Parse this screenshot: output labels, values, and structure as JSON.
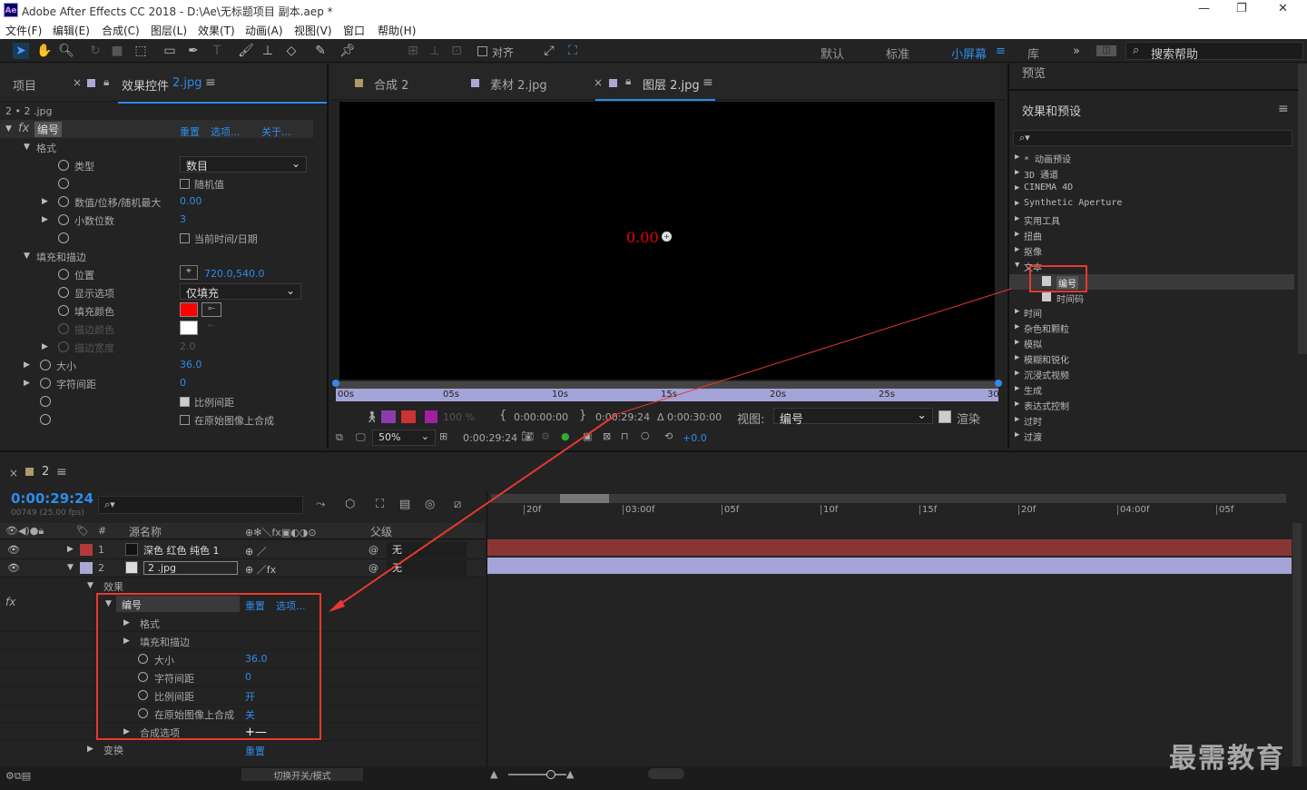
{
  "window": {
    "title": "Adobe After Effects CC 2018 - D:\\Ae\\无标题项目 副本.aep *",
    "logo": "Ae",
    "controls": [
      "—",
      "❐",
      "✕"
    ]
  },
  "menu": [
    "文件(F)",
    "编辑(E)",
    "合成(C)",
    "图层(L)",
    "效果(T)",
    "动画(A)",
    "视图(V)",
    "窗口",
    "帮助(H)"
  ],
  "toolbar": {
    "snap_label": "对齐",
    "workspaces": [
      "默认",
      "标准",
      "小屏幕",
      "库"
    ],
    "active_workspace": "小屏幕",
    "search_help": "搜索帮助"
  },
  "project_panel": {
    "tab_project": "项目",
    "tab_effects": "效果控件",
    "tab_effects_layer": "2.jpg",
    "breadcrumb": "2 • 2 .jpg"
  },
  "effect_controls": {
    "effect_name": "编号",
    "reset": "重置",
    "options": "选项...",
    "about": "关于...",
    "format_group": "格式",
    "type_label": "类型",
    "type_value": "数目",
    "random_label": "随机值",
    "value_label": "数值/位移/随机最大",
    "value_value": "0.00",
    "decimals_label": "小数位数",
    "decimals_value": "3",
    "current_date_label": "当前时间/日期",
    "fill_stroke_group": "填充和描边",
    "position_label": "位置",
    "position_value": "720.0,540.0",
    "display_label": "显示选项",
    "display_value": "仅填充",
    "fill_color_label": "填充颜色",
    "fill_color": "#ff0000",
    "stroke_color_label": "描边颜色",
    "stroke_color": "#ffffff",
    "stroke_width_label": "描边宽度",
    "stroke_width_value": "2.0",
    "size_label": "大小",
    "size_value": "36.0",
    "tracking_label": "字符间距",
    "tracking_value": "0",
    "proportional_label": "比例间距",
    "composite_label": "在原始图像上合成"
  },
  "viewer": {
    "tabs": [
      "合成 2",
      "素材 2.jpg",
      "图层 2.jpg"
    ],
    "active_tab": "图层 2.jpg",
    "canvas_text": "0.00",
    "ruler_labels": [
      "00s",
      "05s",
      "10s",
      "15s",
      "20s",
      "25s",
      "30s"
    ],
    "opacity": "100 %",
    "time_in": "0:00:00:00",
    "time_out": "0:00:29:24",
    "duration": "Δ 0:00:30:00",
    "view_label": "视图:",
    "view_value": "编号",
    "render_label": "渲染",
    "zoom": "50%",
    "current_time": "0:00:29:24",
    "exposure": "+0.0"
  },
  "right_panel": {
    "preview": "预览",
    "effects_presets": "效果和预设",
    "tree": [
      {
        "label": "* 动画预设",
        "open": false
      },
      {
        "label": "3D 通道",
        "open": false
      },
      {
        "label": "CINEMA 4D",
        "open": false
      },
      {
        "label": "Synthetic Aperture",
        "open": false
      },
      {
        "label": "实用工具",
        "open": false
      },
      {
        "label": "扭曲",
        "open": false
      },
      {
        "label": "抠像",
        "open": false
      },
      {
        "label": "文本",
        "open": true
      },
      {
        "label": "编号",
        "child": true,
        "selected": true
      },
      {
        "label": "时间码",
        "child": true
      },
      {
        "label": "时间",
        "open": false
      },
      {
        "label": "杂色和颗粒",
        "open": false
      },
      {
        "label": "模拟",
        "open": false
      },
      {
        "label": "模糊和锐化",
        "open": false
      },
      {
        "label": "沉浸式视频",
        "open": false
      },
      {
        "label": "生成",
        "open": false
      },
      {
        "label": "表达式控制",
        "open": false
      },
      {
        "label": "过时",
        "open": false
      },
      {
        "label": "过渡",
        "open": false
      }
    ]
  },
  "timeline": {
    "comp_tab": "2",
    "timecode": "0:00:29:24",
    "frame_info": "00749 (25.00 fps)",
    "col_source": "源名称",
    "col_parent": "父级",
    "col_num": "#",
    "layers": [
      {
        "num": "1",
        "name": "深色 红色 纯色 1",
        "color": "#b33a3a",
        "parent": "无"
      },
      {
        "num": "2",
        "name": "2 .jpg",
        "color": "#a9a9d4",
        "parent": "无"
      }
    ],
    "effects_label": "效果",
    "fx_name": "编号",
    "fx_reset": "重置",
    "fx_options": "选项...",
    "fx_rows": [
      {
        "label": "格式",
        "val": ""
      },
      {
        "label": "填充和描边",
        "val": ""
      },
      {
        "label": "大小",
        "val": "36.0"
      },
      {
        "label": "字符间距",
        "val": "0"
      },
      {
        "label": "比例间距",
        "val": "开"
      },
      {
        "label": "在原始图像上合成",
        "val": "关"
      },
      {
        "label": "合成选项",
        "val": "+—"
      }
    ],
    "transform": "变换",
    "transform_reset": "重置",
    "ruler": [
      "20f",
      "03:00f",
      "05f",
      "10f",
      "15f",
      "20f",
      "04:00f",
      "05f"
    ],
    "footer": "切换开关/模式"
  },
  "watermark": "最需教育"
}
